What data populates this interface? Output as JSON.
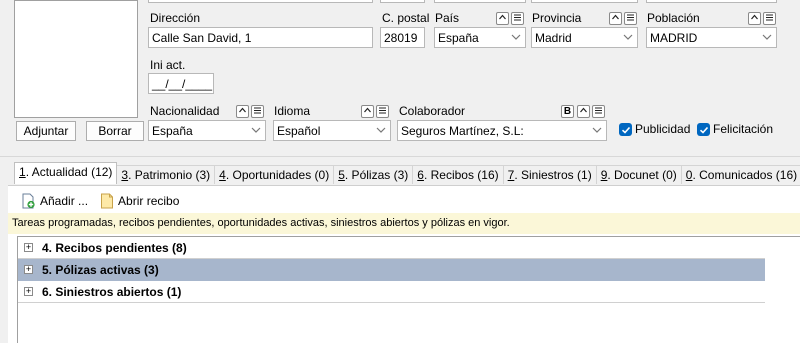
{
  "photo": {
    "adjust_label": "Adjuntar",
    "delete_label": "Borrar"
  },
  "address": {
    "direccion_label": "Dirección",
    "direccion_value": "Calle San David, 1",
    "cpostal_label": "C. postal",
    "cpostal_value": "28019",
    "pais_label": "País",
    "pais_value": "España",
    "provincia_label": "Provincia",
    "provincia_value": "Madrid",
    "poblacion_label": "Población",
    "poblacion_value": "MADRID"
  },
  "ini_act": {
    "label": "Ini act.",
    "value": "__/__/____"
  },
  "misc": {
    "nacionalidad_label": "Nacionalidad",
    "nacionalidad_value": "España",
    "idioma_label": "Idioma",
    "idioma_value": "Español",
    "colaborador_label": "Colaborador",
    "colaborador_value": "Seguros Martínez, S.L:",
    "publicidad_label": "Publicidad",
    "felicitacion_label": "Felicitación",
    "b_button": "B"
  },
  "tabs": [
    {
      "key": "1",
      "rest": ". Actualidad (12)"
    },
    {
      "key": "3",
      "rest": ". Patrimonio (3)"
    },
    {
      "key": "4",
      "rest": ". Oportunidades (0)"
    },
    {
      "key": "5",
      "rest": ". Pólizas (3)"
    },
    {
      "key": "6",
      "rest": ". Recibos (16)"
    },
    {
      "key": "7",
      "rest": ". Siniestros (1)"
    },
    {
      "key": "9",
      "rest": ". Docunet (0)"
    },
    {
      "key": "0",
      "rest": ". Comunicados (16)"
    }
  ],
  "toolbar": {
    "add_label": "Añadir ...",
    "open_receipt_label": "Abrir recibo"
  },
  "info_text": "Tareas programadas, recibos pendientes, oportunidades activas, siniestros abiertos y pólizas en vigor.",
  "tree": [
    {
      "label": "4. Recibos pendientes (8)"
    },
    {
      "label": "5. Pólizas activas (3)"
    },
    {
      "label": "6. Siniestros abiertos (1)"
    }
  ],
  "icons": {
    "expand": "plus-box-icon",
    "dropdown": "chevron-down-icon",
    "up": "caret-up-icon",
    "list": "list-icon"
  },
  "colors": {
    "checkbox": "#0067c0",
    "selected_row": "#a7b6cc",
    "info_bg": "#fbf7d8"
  }
}
